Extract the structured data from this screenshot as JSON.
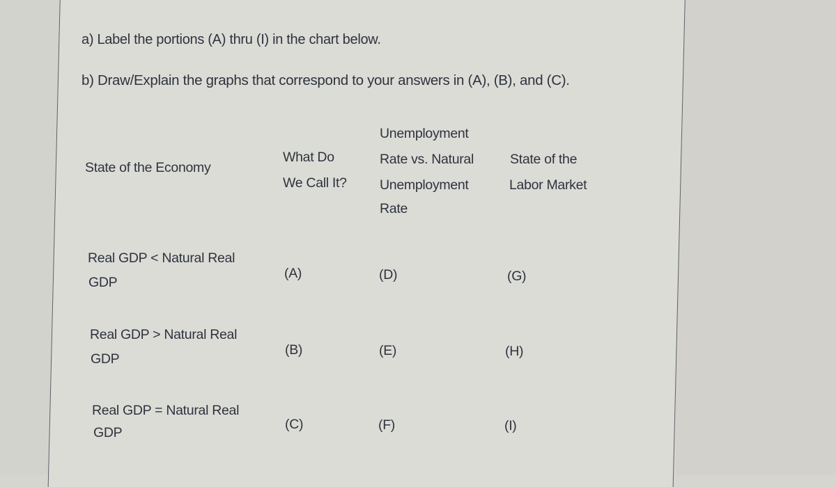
{
  "instructions": {
    "part_a": "a) Label the portions (A) thru (I) in the chart below.",
    "part_b": "b) Draw/Explain the graphs that correspond to your answers in (A), (B), and (C)."
  },
  "table": {
    "headers": {
      "state_of_economy": "State of the Economy",
      "what_do_we_call_it": [
        "What Do",
        "We Call It?"
      ],
      "unemployment_rate": [
        "Unemployment",
        "Rate vs. Natural",
        "Unemployment",
        "Rate"
      ],
      "labor_market": [
        "State of the",
        "Labor Market"
      ]
    },
    "rows": [
      {
        "state": [
          "Real GDP < Natural Real",
          "GDP"
        ],
        "name": "(A)",
        "unemployment": "(D)",
        "labor": "(G)"
      },
      {
        "state": [
          "Real GDP > Natural Real",
          "GDP"
        ],
        "name": "(B)",
        "unemployment": "(E)",
        "labor": "(H)"
      },
      {
        "state": [
          "Real GDP = Natural Real",
          "GDP"
        ],
        "name": "(C)",
        "unemployment": "(F)",
        "labor": "(I)"
      }
    ]
  }
}
